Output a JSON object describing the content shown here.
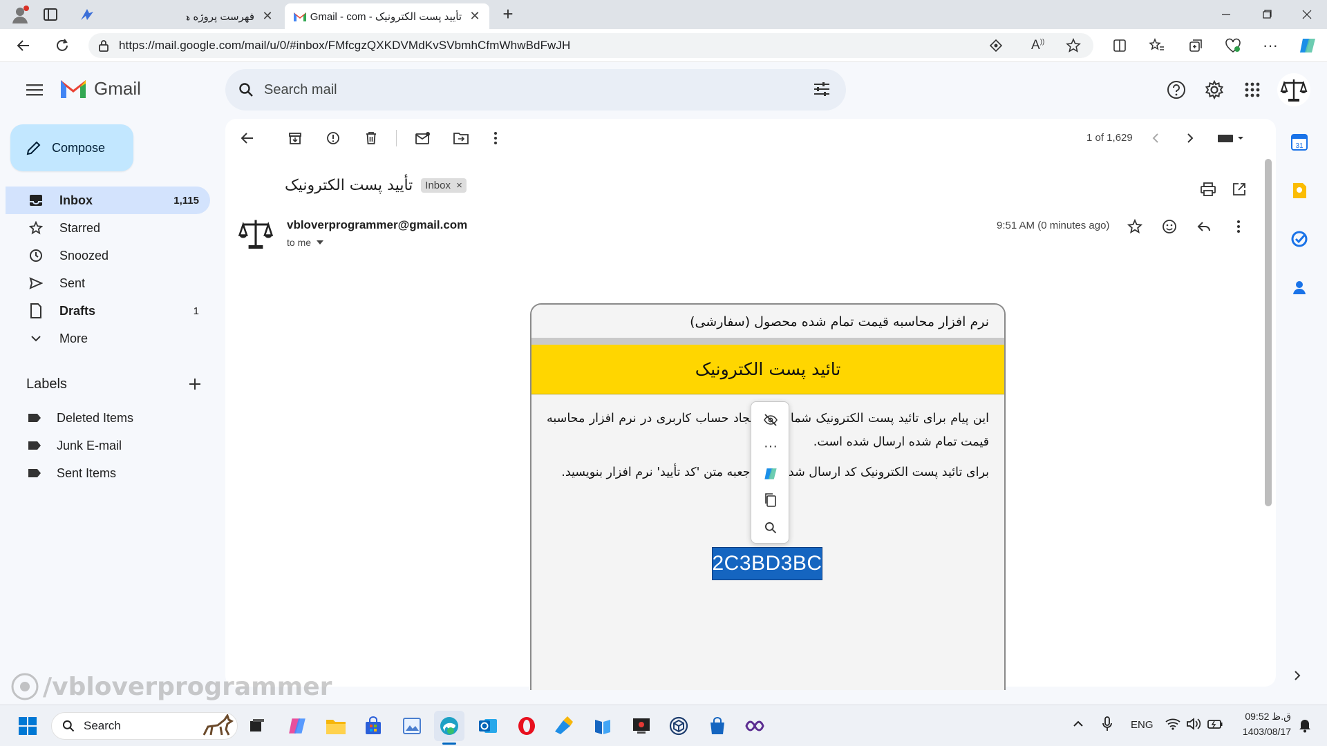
{
  "browser": {
    "tabs": [
      {
        "title": "فهرست پروژه ها",
        "active": false
      },
      {
        "title": "تأیید پست الکترونیک - Gmail - com",
        "active": true
      }
    ],
    "url": "https://mail.google.com/mail/u/0/#inbox/FMfcgzQXKDVMdKvSVbmhCfmWhwBdFwJH"
  },
  "gmail": {
    "logo_text": "Gmail",
    "search_placeholder": "Search mail",
    "compose_label": "Compose",
    "nav": [
      {
        "label": "Inbox",
        "count": "1,115"
      },
      {
        "label": "Starred",
        "count": ""
      },
      {
        "label": "Snoozed",
        "count": ""
      },
      {
        "label": "Sent",
        "count": ""
      },
      {
        "label": "Drafts",
        "count": "1"
      },
      {
        "label": "More",
        "count": ""
      }
    ],
    "labels_heading": "Labels",
    "labels": [
      "Deleted Items",
      "Junk E-mail",
      "Sent Items"
    ],
    "pagination": "1 of 1,629"
  },
  "message": {
    "subject": "تأیید پست الکترونیک",
    "label_chip": "Inbox",
    "sender": "vbloverprogrammer@gmail.com",
    "recipient": "to me",
    "time": "9:51 AM (0 minutes ago)",
    "body": {
      "app_title": "نرم افزار محاسبه قیمت تمام شده محصول (سفارشی)",
      "banner": "تائید پست الکترونیک",
      "paragraph1": "این پیام برای تائید پست الکترونیک شما جهت ایجاد حساب کاربری در نرم افزار محاسبه قیمت تمام شده ارسال شده است.",
      "paragraph2": "برای تائید پست الکترونیک کد ارسال شده را در جعبه متن 'کد تأیید' نرم افزار بنویسید.",
      "code": "2C3BD3BC"
    }
  },
  "watermark": "/vbloverprogrammer",
  "taskbar": {
    "search_label": "Search",
    "language": "ENG",
    "time": "09:52 ق.ظ",
    "date": "1403/08/17"
  },
  "colors": {
    "gmail_red": "#ea4335",
    "compose_bg": "#c2e7ff",
    "inbox_selected": "#d3e3fd",
    "banner_yellow": "#ffd600",
    "code_highlight": "#1565c0"
  }
}
